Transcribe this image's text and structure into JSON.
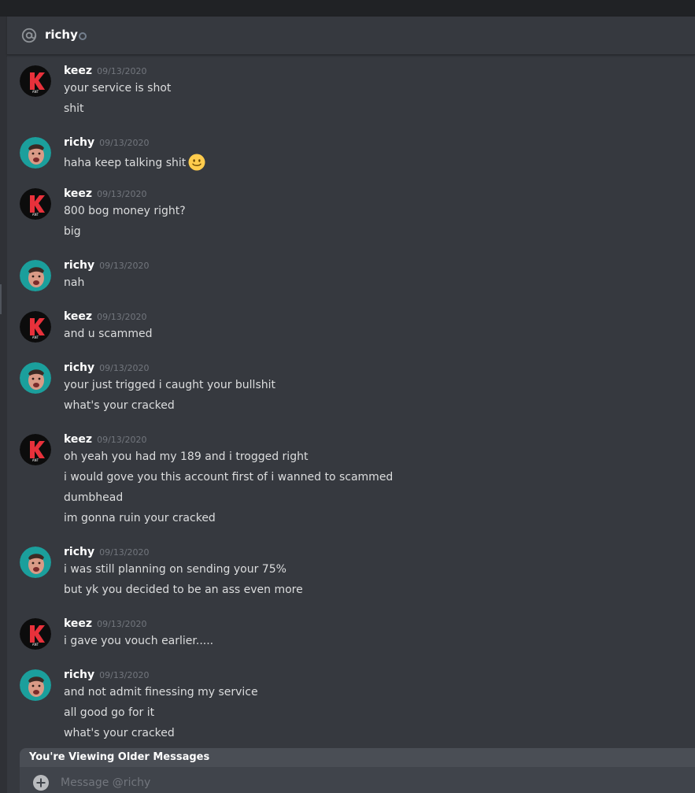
{
  "channel": {
    "name": "richy"
  },
  "messages": [
    {
      "author": "keez",
      "timestamp": "09/13/2020",
      "avatar": "k-logo-avatar",
      "lines": [
        "your service is shot",
        "shit"
      ]
    },
    {
      "author": "richy",
      "timestamp": "09/13/2020",
      "avatar": "face-avatar",
      "lines": [
        "haha keep talking shit"
      ],
      "emoji": "slightly-smiling-face-emoji"
    },
    {
      "author": "keez",
      "timestamp": "09/13/2020",
      "avatar": "k-logo-avatar",
      "lines": [
        "800 bog money right?",
        "big"
      ]
    },
    {
      "author": "richy",
      "timestamp": "09/13/2020",
      "avatar": "face-avatar",
      "lines": [
        "nah"
      ]
    },
    {
      "author": "keez",
      "timestamp": "09/13/2020",
      "avatar": "k-logo-avatar",
      "lines": [
        "and u scammed"
      ]
    },
    {
      "author": "richy",
      "timestamp": "09/13/2020",
      "avatar": "face-avatar",
      "lines": [
        "your just trigged i caught your bullshit",
        "what's your cracked"
      ]
    },
    {
      "author": "keez",
      "timestamp": "09/13/2020",
      "avatar": "k-logo-avatar",
      "lines": [
        "oh yeah you had my 189 and i trogged right",
        "i would gove you this account first of i wanned to scammed",
        "dumbhead",
        "im gonna ruin your cracked"
      ]
    },
    {
      "author": "richy",
      "timestamp": "09/13/2020",
      "avatar": "face-avatar",
      "lines": [
        "i was still planning on sending your 75%",
        "but yk you decided to be an ass even more"
      ]
    },
    {
      "author": "keez",
      "timestamp": "09/13/2020",
      "avatar": "k-logo-avatar",
      "lines": [
        "i gave you vouch earlier....."
      ]
    },
    {
      "author": "richy",
      "timestamp": "09/13/2020",
      "avatar": "face-avatar",
      "lines": [
        "and not admit finessing my service",
        "all good go for it",
        "what's your cracked"
      ]
    }
  ],
  "older_bar": {
    "label": "You're Viewing Older Messages"
  },
  "composer": {
    "placeholder": "Message @richy"
  },
  "icons": {
    "header": "at-sign-icon",
    "status": "offline-status-icon",
    "attach": "add-attachment-icon"
  },
  "colors": {
    "background": "#36393f",
    "header": "#36393f",
    "timestamp": "#72767d",
    "text": "#dcddde",
    "keez_avatar": "#0c0c0c",
    "keez_logo": "#e8313b",
    "richy_avatar": "#1b9f9c"
  }
}
